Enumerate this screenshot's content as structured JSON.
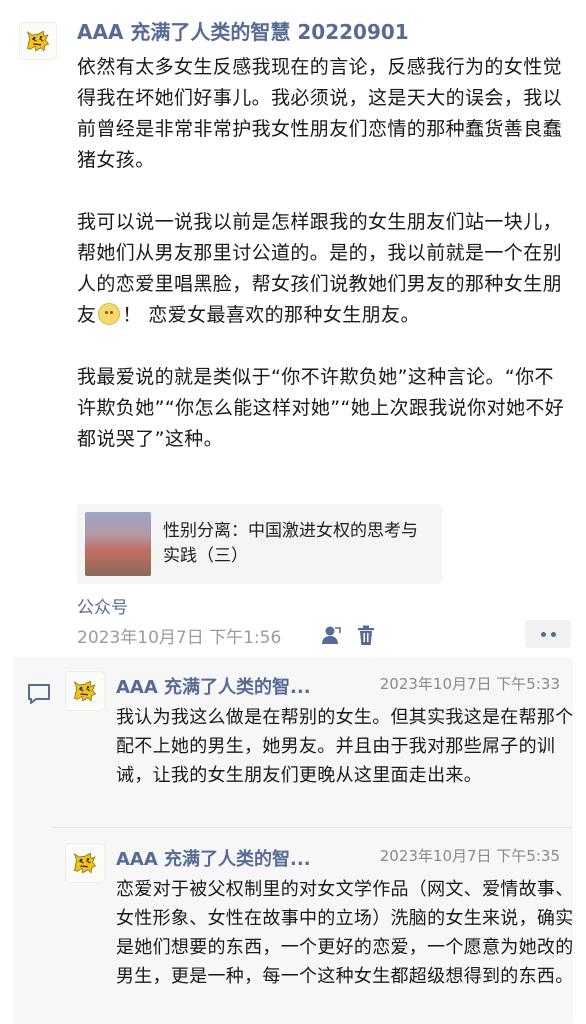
{
  "post": {
    "author": "AAA 充满了人类的智慧 20220901",
    "paragraphs": [
      "依然有太多女生反感我现在的言论，反感我行为的女性觉得我在坏她们好事儿。我必须说，这是天大的误会，我以前曾经是非常非常护我女性朋友们恋情的那种蠢货善良蠢猪女孩。",
      "我可以说一说我以前是怎样跟我的女生朋友们站一块儿，帮她们从男友那里讨公道的。是的，我以前就是一个在别人的恋爱里唱黑脸，帮女孩们说教她们男友的那种女生朋友",
      "我最爱说的就是类似于“你不许欺负她”这种言论。“你不许欺负她”“你怎么能这样对她”“她上次跟我说你对她不好都说哭了”这种。"
    ],
    "paragraph2_tail": "！ 恋爱女最喜欢的那种女生朋友。",
    "emoji": "smile-emoji",
    "link_card": {
      "title": "性别分离：中国激进女权的思考与实践（三）"
    },
    "source": "公众号",
    "timestamp": "2023年10月7日 下午1:56",
    "icons": [
      "person-icon",
      "trash-icon",
      "more-icon"
    ]
  },
  "comments": [
    {
      "author": "AAA 充满了人类的智...",
      "time": "2023年10月7日 下午5:33",
      "text": "我认为我这么做是在帮别的女生。但其实我这是在帮那个配不上她的男生，她男友。并且由于我对那些屌子的训诫，让我的女生朋友们更晚从这里面走出来。"
    },
    {
      "author": "AAA 充满了人类的智...",
      "time": "2023年10月7日 下午5:35",
      "text": "恋爱对于被父权制里的对女文学作品（网文、爱情故事、女性形象、女性在故事中的立场）洗脑的女生来说，确实是她们想要的东西，一个更好的恋爱，一个愿意为她改的男生，更是一种，每一个这种女生都超级想得到的东西。"
    }
  ],
  "colors": {
    "link_blue": "#576b95",
    "meta_gray": "#9b9b9b",
    "panel_bg": "#f7f7f7"
  }
}
